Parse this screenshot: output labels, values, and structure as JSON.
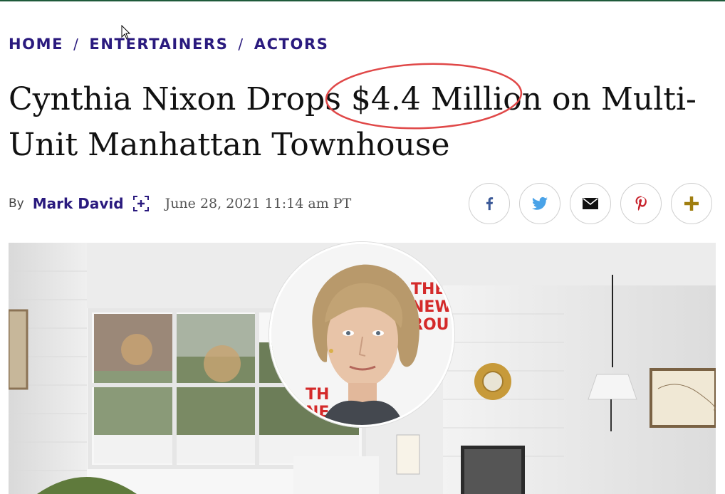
{
  "breadcrumb": {
    "items": [
      "HOME",
      "ENTERTAINERS",
      "ACTORS"
    ],
    "separator": "/"
  },
  "article": {
    "title_before": "Cynthia Nixon Drops ",
    "title_highlight": "$4.4 Million",
    "title_after": " on Multi-Unit Manhattan Townhouse",
    "by_label": "By",
    "author": "Mark David",
    "date": "June 28, 2021 11:14 am PT"
  },
  "share": {
    "buttons": [
      {
        "name": "facebook",
        "icon": "facebook-icon",
        "color": "#3b5998"
      },
      {
        "name": "twitter",
        "icon": "twitter-icon",
        "color": "#4aa3e8"
      },
      {
        "name": "email",
        "icon": "email-icon",
        "color": "#111111"
      },
      {
        "name": "pinterest",
        "icon": "pinterest-icon",
        "color": "#c8232c"
      },
      {
        "name": "more",
        "icon": "plus-icon",
        "color": "#a07e10"
      }
    ]
  },
  "colors": {
    "brand": "#2a1a7e",
    "annotation": "#e04848",
    "top_rule": "#1e5a3a"
  },
  "images": {
    "hero": "living-room-photo",
    "portrait": "cynthia-nixon-portrait",
    "backdrop_letters_top": "THE\nNEW\nROU",
    "backdrop_letters_bottom": "TH\nNE"
  }
}
